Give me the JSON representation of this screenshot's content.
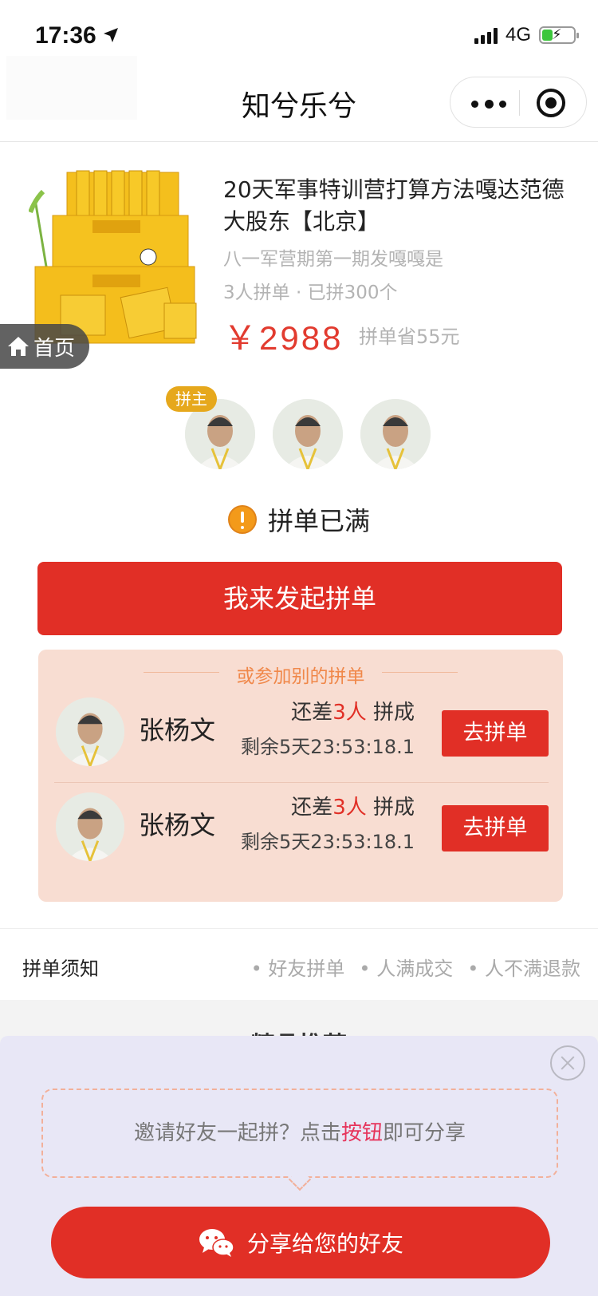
{
  "status_bar": {
    "time": "17:36",
    "network": "4G",
    "battery_level": 0.3
  },
  "nav": {
    "title": "知兮乐兮"
  },
  "product": {
    "title": "20天军事特训营打算方法嘎达范德大股东【北京】",
    "subtitle": "八一军营期第一期发嘎嘎是",
    "meta": "3人拼单 · 已拼300个",
    "price": "￥2988",
    "saved": "拼单省55元"
  },
  "home_button": {
    "label": "首页"
  },
  "group": {
    "owner_tag": "拼主",
    "status_text": "拼单已满"
  },
  "start_button": {
    "label": "我来发起拼单"
  },
  "other_groups": {
    "title": "或参加别的拼单",
    "rows": [
      {
        "name": "张杨文",
        "need_prefix": "还差",
        "need_count": "3人",
        "need_suffix": " 拼成",
        "remaining": "剩余5天23:53:18.1",
        "button": "去拼单"
      },
      {
        "name": "张杨文",
        "need_prefix": "还差",
        "need_count": "3人",
        "need_suffix": " 拼成",
        "remaining": "剩余5天23:53:18.1",
        "button": "去拼单"
      }
    ]
  },
  "notice": {
    "title": "拼单须知",
    "items": [
      "• 好友拼单",
      "• 人满成交",
      "• 人不满退款"
    ]
  },
  "recommend": {
    "title": "精品推荐"
  },
  "share_popup": {
    "tip_prefix": "邀请好友一起拼？点击",
    "tip_highlight": "按钮",
    "tip_suffix": "即可分享",
    "button": "分享给您的好友"
  },
  "colors": {
    "accent": "#e12f26",
    "owner_tag": "#e6a81c",
    "panel_bg": "#f8ddd2",
    "popup_bg": "#e8e7f6"
  },
  "icons": [
    "location-arrow-icon",
    "signal-icon",
    "battery-icon",
    "more-dots-icon",
    "close-mini-program-icon",
    "home-icon",
    "warning-icon",
    "close-circle-icon",
    "wechat-icon"
  ]
}
